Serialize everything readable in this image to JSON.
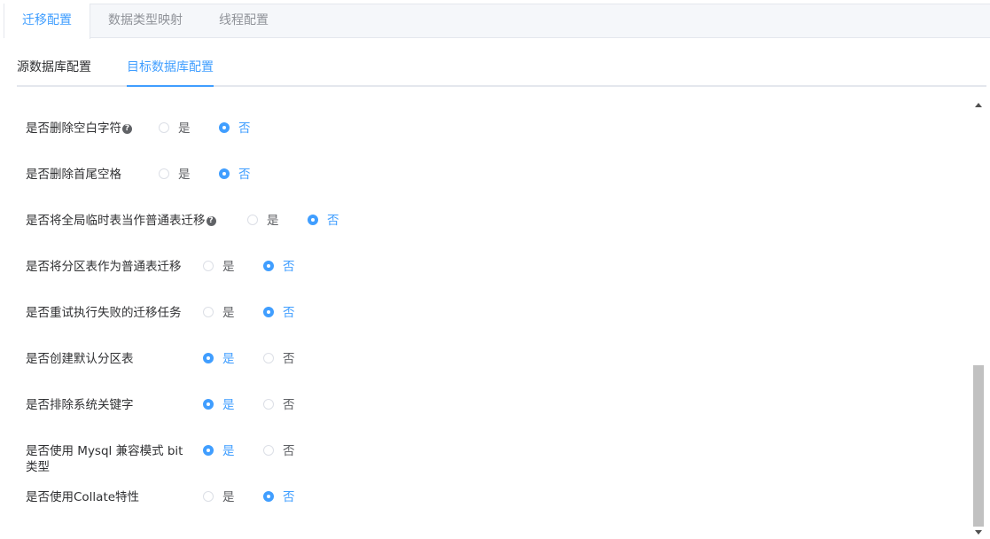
{
  "top_tabs": [
    {
      "label": "迁移配置",
      "active": true
    },
    {
      "label": "数据类型映射",
      "active": false
    },
    {
      "label": "线程配置",
      "active": false
    }
  ],
  "sub_tabs": [
    {
      "label": "源数据库配置",
      "active": false
    },
    {
      "label": "目标数据库配置",
      "active": true
    }
  ],
  "options": {
    "yes": "是",
    "no": "否"
  },
  "help_icon": "question-circle-icon",
  "settings": [
    {
      "label": "是否删除空白字符",
      "help": true,
      "value": "否"
    },
    {
      "label": "是否删除首尾空格",
      "help": false,
      "value": "否"
    },
    {
      "label": "是否将全局临时表当作普通表迁移",
      "help": true,
      "value": "否"
    },
    {
      "label": "是否将分区表作为普通表迁移",
      "help": false,
      "value": "否"
    },
    {
      "label": "是否重试执行失败的迁移任务",
      "help": false,
      "value": "否"
    },
    {
      "label": "是否创建默认分区表",
      "help": false,
      "value": "是"
    },
    {
      "label": "是否排除系统关键字",
      "help": false,
      "value": "是"
    },
    {
      "label": "是否使用 Mysql 兼容模式 bit 类型",
      "help": false,
      "value": "是"
    },
    {
      "label": "是否使用Collate特性",
      "help": false,
      "value": "否"
    }
  ],
  "colors": {
    "accent": "#409eff",
    "text": "#303133",
    "muted": "#909399"
  }
}
